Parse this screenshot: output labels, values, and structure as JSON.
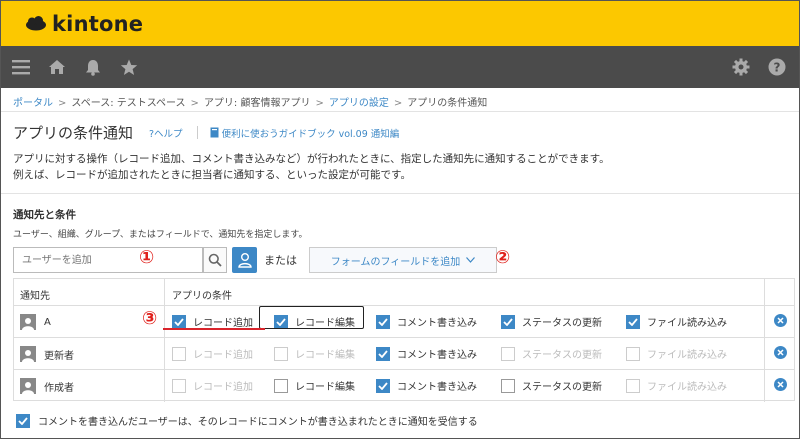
{
  "header": {
    "logo_text": "kintone",
    "brand_color": "#fcc800"
  },
  "nav": {
    "icons": [
      "menu-icon",
      "home-icon",
      "bell-icon",
      "star-icon",
      "gear-icon",
      "help-icon"
    ]
  },
  "breadcrumb": {
    "portal": "ポータル",
    "space": "スペース: テストスペース",
    "app": "アプリ: 顧客情報アプリ",
    "settings": "アプリの設定",
    "current": "アプリの条件通知"
  },
  "page": {
    "title": "アプリの条件通知",
    "help": "?ヘルプ",
    "guide": "便利に使おうガイドブック vol.09 通知編",
    "desc_line1": "アプリに対する操作（レコード追加、コメント書き込みなど）が行われたときに、指定した通知先に通知することができます。",
    "desc_line2": "例えば、レコードが追加されたときに担当者に通知する、といった設定が可能です。"
  },
  "section": {
    "heading": "通知先と条件",
    "subtext": "ユーザー、組織、グループ、またはフィールドで、通知先を指定します。",
    "search_placeholder": "ユーザーを追加",
    "or_text": "または",
    "field_button": "フォームのフィールドを追加"
  },
  "markers": {
    "m1": "①",
    "m2": "②",
    "m3": "③"
  },
  "table": {
    "col_target": "通知先",
    "col_conditions": "アプリの条件",
    "rows": [
      {
        "name": "A",
        "conds": [
          {
            "label": "レコード追加",
            "checked": true,
            "disabled": false
          },
          {
            "label": "レコード編集",
            "checked": true,
            "disabled": false
          },
          {
            "label": "コメント書き込み",
            "checked": true,
            "disabled": false
          },
          {
            "label": "ステータスの更新",
            "checked": true,
            "disabled": false
          },
          {
            "label": "ファイル読み込み",
            "checked": true,
            "disabled": false
          }
        ]
      },
      {
        "name": "更新者",
        "conds": [
          {
            "label": "レコード追加",
            "checked": false,
            "disabled": true
          },
          {
            "label": "レコード編集",
            "checked": false,
            "disabled": true
          },
          {
            "label": "コメント書き込み",
            "checked": true,
            "disabled": false
          },
          {
            "label": "ステータスの更新",
            "checked": false,
            "disabled": true
          },
          {
            "label": "ファイル読み込み",
            "checked": false,
            "disabled": true
          }
        ]
      },
      {
        "name": "作成者",
        "conds": [
          {
            "label": "レコード追加",
            "checked": false,
            "disabled": true
          },
          {
            "label": "レコード編集",
            "checked": false,
            "disabled": false
          },
          {
            "label": "コメント書き込み",
            "checked": true,
            "disabled": false
          },
          {
            "label": "ステータスの更新",
            "checked": false,
            "disabled": false
          },
          {
            "label": "ファイル読み込み",
            "checked": false,
            "disabled": true
          }
        ]
      }
    ]
  },
  "footer": {
    "label": "コメントを書き込んだユーザーは、そのレコードにコメントが書き込まれたときに通知を受信する",
    "checked": true
  },
  "colors": {
    "accent": "#3d88c6",
    "annotation_red": "#e0201b"
  }
}
